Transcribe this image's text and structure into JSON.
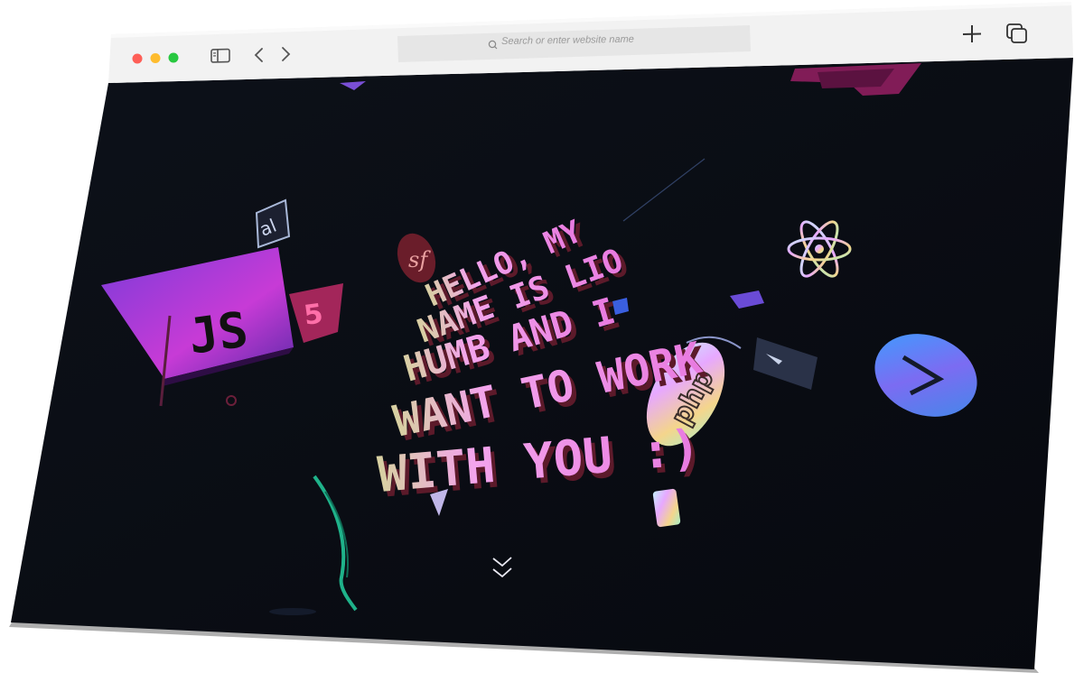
{
  "toolbar": {
    "search_placeholder": "Search or enter website name"
  },
  "hero": {
    "lines": [
      "HELLO, MY",
      "NAME IS LIO",
      "HUMB AND I",
      "WANT TO WORK",
      "WITH YOU :)"
    ]
  },
  "icons": [
    "sidebar-icon",
    "back-icon",
    "forward-icon",
    "search-icon",
    "new-tab-icon",
    "tabs-overview-icon",
    "js-logo-icon",
    "html5-logo-icon",
    "symfony-logo-icon",
    "react-logo-icon",
    "php-logo-icon",
    "mariadb-logo-icon",
    "scroll-down-icon"
  ],
  "colors": {
    "page_bg": "#0b0e17",
    "toolbar_bg": "#f1f1f1",
    "accent_pink": "#e06bd9",
    "accent_purple": "#8a4cff",
    "traffic_red": "#fe5f57",
    "traffic_yellow": "#febc2e",
    "traffic_green": "#28c840"
  }
}
